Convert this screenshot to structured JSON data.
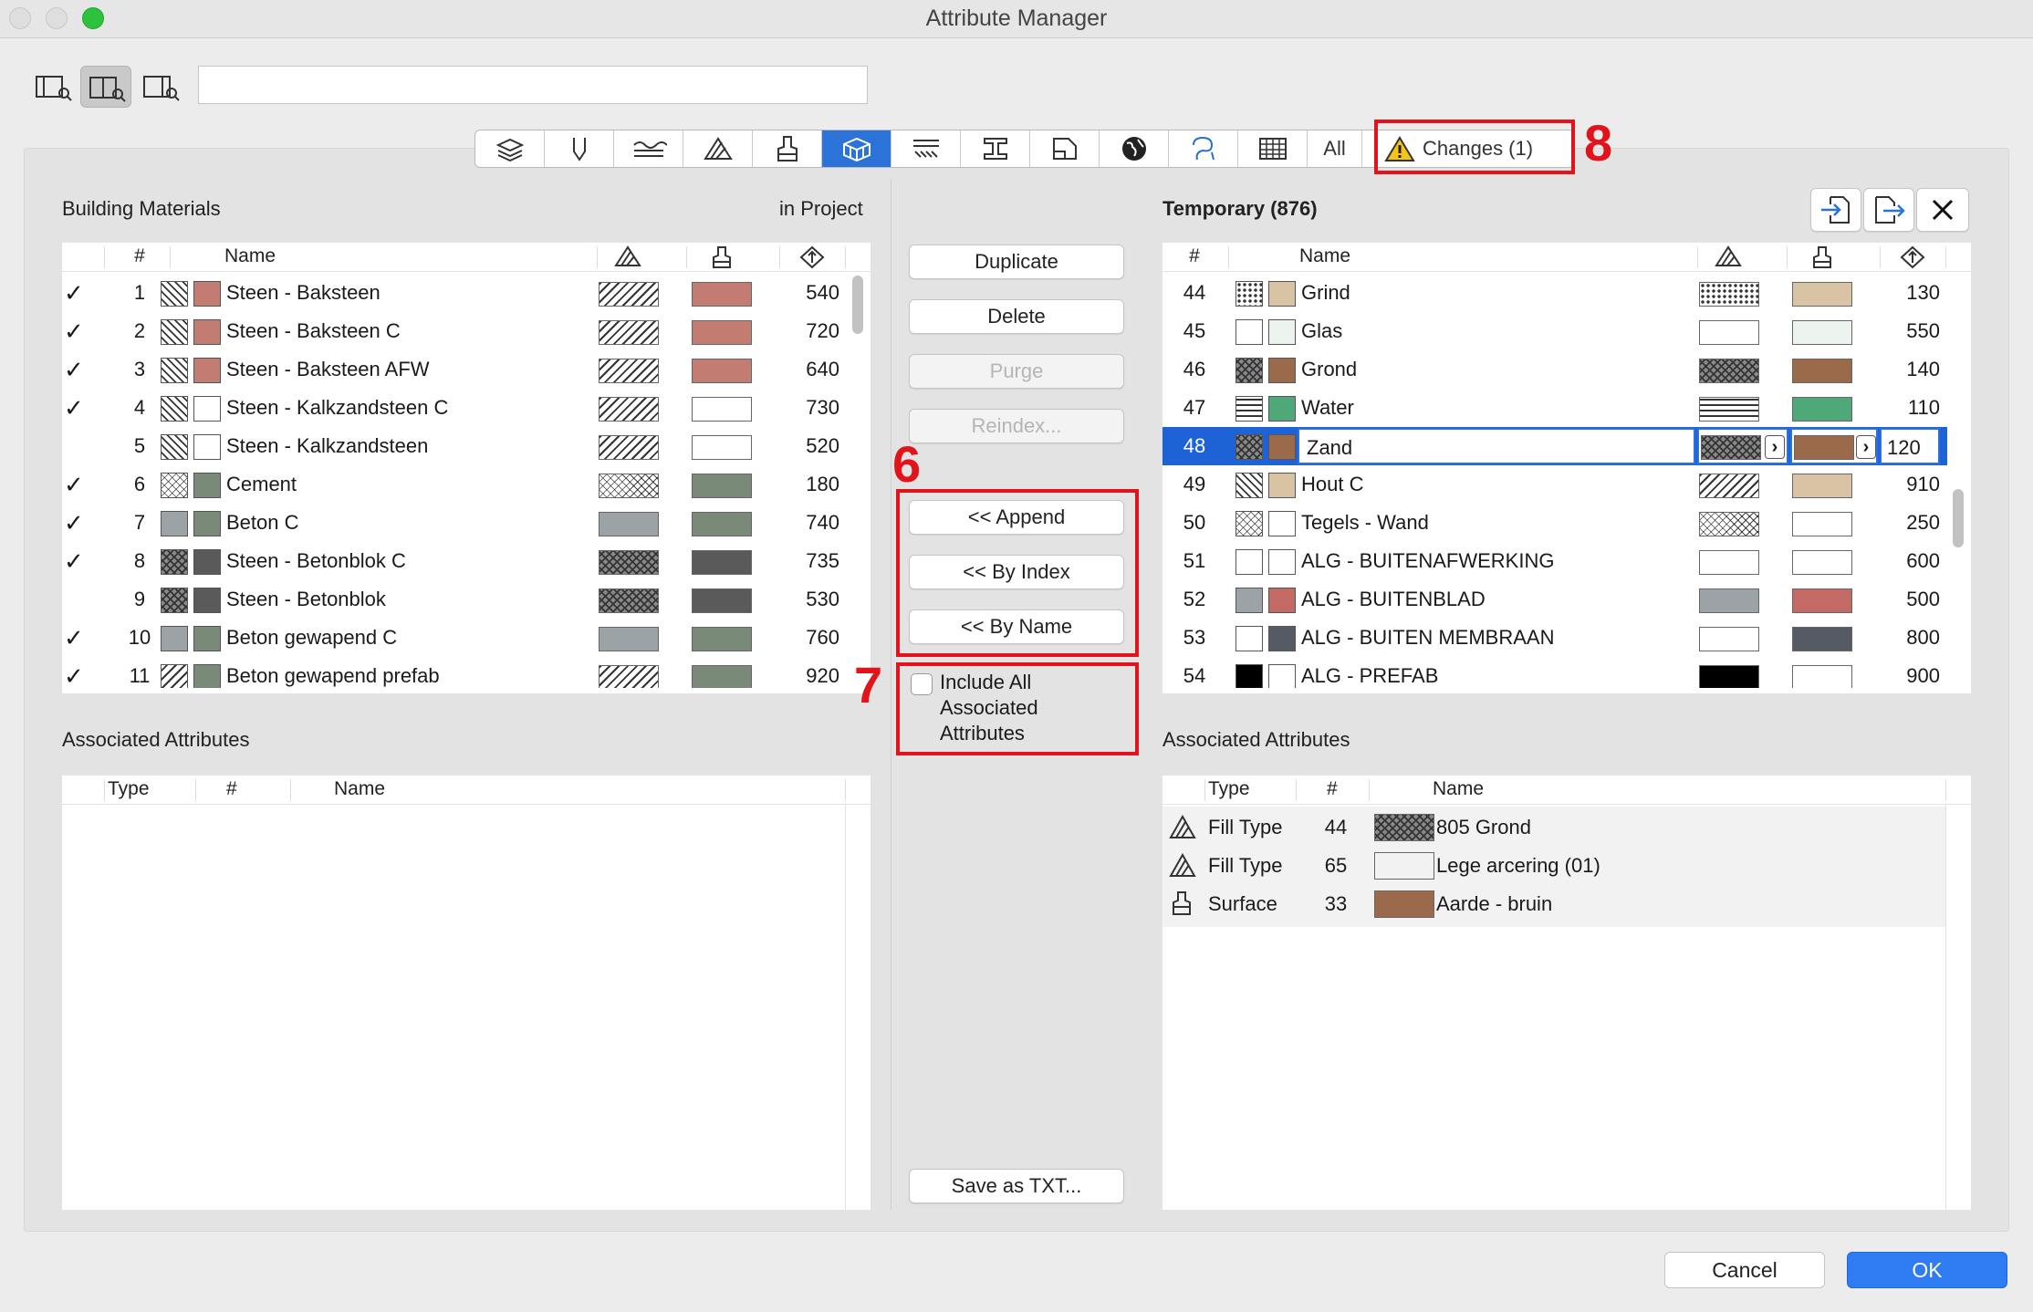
{
  "window": {
    "title": "Attribute Manager"
  },
  "toolbar": {
    "search_value": ""
  },
  "tabs": {
    "all_label": "All",
    "changes_label": "Changes (1)"
  },
  "callouts": {
    "n6": "6",
    "n7": "7",
    "n8": "8"
  },
  "left": {
    "title": "Building Materials",
    "scope": "in Project",
    "headers": {
      "index": "#",
      "name": "Name"
    },
    "rows": [
      {
        "check": "✓",
        "index": "1",
        "name": "Steen - Baksteen",
        "value": "540"
      },
      {
        "check": "✓",
        "index": "2",
        "name": "Steen - Baksteen C",
        "value": "720"
      },
      {
        "check": "✓",
        "index": "3",
        "name": "Steen - Baksteen AFW",
        "value": "640"
      },
      {
        "check": "✓",
        "index": "4",
        "name": "Steen - Kalkzandsteen C",
        "value": "730"
      },
      {
        "check": "",
        "index": "5",
        "name": "Steen - Kalkzandsteen",
        "value": "520"
      },
      {
        "check": "✓",
        "index": "6",
        "name": "Cement",
        "value": "180"
      },
      {
        "check": "✓",
        "index": "7",
        "name": "Beton C",
        "value": "740"
      },
      {
        "check": "✓",
        "index": "8",
        "name": "Steen - Betonblok C",
        "value": "735"
      },
      {
        "check": "",
        "index": "9",
        "name": "Steen - Betonblok",
        "value": "530"
      },
      {
        "check": "✓",
        "index": "10",
        "name": "Beton gewapend C",
        "value": "760"
      },
      {
        "check": "✓",
        "index": "11",
        "name": "Beton gewapend prefab",
        "value": "920"
      }
    ],
    "assoc_title": "Associated Attributes",
    "assoc_headers": {
      "type": "Type",
      "index": "#",
      "name": "Name"
    }
  },
  "middle": {
    "duplicate": "Duplicate",
    "delete": "Delete",
    "purge": "Purge",
    "reindex": "Reindex...",
    "append": "<< Append",
    "by_index": "<< By Index",
    "by_name": "<< By Name",
    "include_all": "Include All Associated Attributes",
    "save_txt": "Save as TXT..."
  },
  "right": {
    "title": "Temporary (876)",
    "headers": {
      "index": "#",
      "name": "Name"
    },
    "rows": [
      {
        "index": "44",
        "name": "Grind",
        "value": "130"
      },
      {
        "index": "45",
        "name": "Glas",
        "value": "550"
      },
      {
        "index": "46",
        "name": "Grond",
        "value": "140"
      },
      {
        "index": "47",
        "name": "Water",
        "value": "110"
      },
      {
        "index": "48",
        "name": "Zand",
        "value": "120"
      },
      {
        "index": "49",
        "name": "Hout C",
        "value": "910"
      },
      {
        "index": "50",
        "name": "Tegels - Wand",
        "value": "250"
      },
      {
        "index": "51",
        "name": "ALG - BUITENAFWERKING",
        "value": "600"
      },
      {
        "index": "52",
        "name": "ALG - BUITENBLAD",
        "value": "500"
      },
      {
        "index": "53",
        "name": "ALG - BUITEN MEMBRAAN",
        "value": "800"
      },
      {
        "index": "54",
        "name": "ALG - PREFAB",
        "value": "900"
      }
    ],
    "assoc_title": "Associated Attributes",
    "assoc_headers": {
      "type": "Type",
      "index": "#",
      "name": "Name"
    },
    "assoc_rows": [
      {
        "type": "Fill Type",
        "index": "44",
        "name": "805 Grond"
      },
      {
        "type": "Fill Type",
        "index": "65",
        "name": "Lege arcering (01)"
      },
      {
        "type": "Surface",
        "index": "33",
        "name": "Aarde - bruin"
      }
    ]
  },
  "footer": {
    "cancel": "Cancel",
    "ok": "OK"
  }
}
